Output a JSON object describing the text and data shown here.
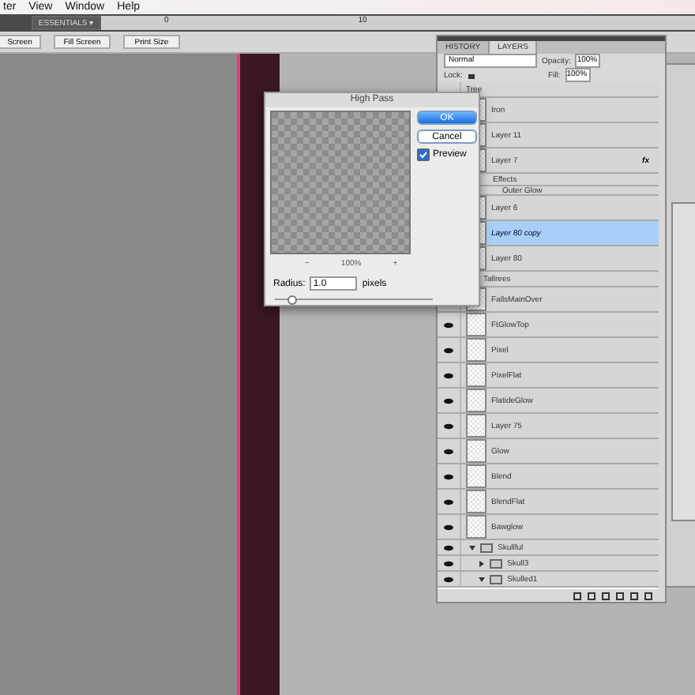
{
  "menu": [
    "ter",
    "View",
    "Window",
    "Help"
  ],
  "workspace": {
    "label": "ESSENTIALS ▾"
  },
  "ruler": [
    "0",
    "10"
  ],
  "zoom_buttons": [
    "Screen",
    "Fill Screen",
    "Print Size"
  ],
  "dialog": {
    "title": "High Pass",
    "zoom": "100%",
    "minus": "−",
    "plus": "+",
    "radius_label": "Radius:",
    "radius": "1.0",
    "unit": "pixels",
    "slider": {
      "level": 0.08
    },
    "ok": "OK",
    "cancel": "Cancel",
    "preview": {
      "label": "Preview",
      "checked": true
    }
  },
  "layers_panel": {
    "tabs": [
      {
        "label": "HISTORY",
        "selected": false
      },
      {
        "label": "LAYERS",
        "selected": true
      }
    ],
    "blend": "Normal",
    "opacity_label": "Opacity:",
    "opacity": "100%",
    "lock_label": "Lock:",
    "fill_label": "Fill:",
    "fill": "100%",
    "layers": [
      {
        "kind": "small",
        "name": "Tree",
        "selected": false
      },
      {
        "kind": "layer",
        "name": "Iron",
        "selected": false
      },
      {
        "kind": "layer",
        "name": "Layer 11",
        "selected": false
      },
      {
        "kind": "layer",
        "name": "Layer 7",
        "selected": false,
        "fx": "fx"
      },
      {
        "kind": "effects",
        "name": "Effects",
        "selected": false
      },
      {
        "kind": "effect",
        "name": "Outer Glow",
        "selected": false
      },
      {
        "kind": "layer",
        "name": "Layer 6",
        "selected": false
      },
      {
        "kind": "layer",
        "name": "Layer 80 copy",
        "selected": true
      },
      {
        "kind": "layer",
        "name": "Layer 80",
        "selected": false
      },
      {
        "kind": "group",
        "name": "Tallrees",
        "selected": false
      },
      {
        "kind": "layer",
        "name": "FallsMainOver",
        "selected": false
      },
      {
        "kind": "layer",
        "name": "FtGlowTop",
        "visible": true,
        "selected": false
      },
      {
        "kind": "layer",
        "name": "Pixel",
        "visible": true,
        "selected": false
      },
      {
        "kind": "layer",
        "name": "PixelFlat",
        "visible": true,
        "selected": false
      },
      {
        "kind": "layer",
        "name": "FlatideGlow",
        "visible": true,
        "selected": false
      },
      {
        "kind": "layer",
        "name": "Layer 75",
        "visible": true,
        "selected": false
      },
      {
        "kind": "layer",
        "name": "Glow",
        "visible": true,
        "selected": false
      },
      {
        "kind": "layer",
        "name": "Blend",
        "visible": true,
        "selected": false
      },
      {
        "kind": "layer",
        "name": "BlendFlat",
        "visible": true,
        "selected": false
      },
      {
        "kind": "layer",
        "name": "Bawglow",
        "visible": true,
        "selected": false
      },
      {
        "kind": "group",
        "name": "Skullful",
        "visible": true,
        "selected": false,
        "expanded": true
      },
      {
        "kind": "subgroup",
        "name": "Skull3",
        "visible": true,
        "selected": false,
        "expanded": false
      },
      {
        "kind": "subgroup",
        "name": "Skulled1",
        "visible": true,
        "selected": false,
        "expanded": true
      }
    ]
  }
}
